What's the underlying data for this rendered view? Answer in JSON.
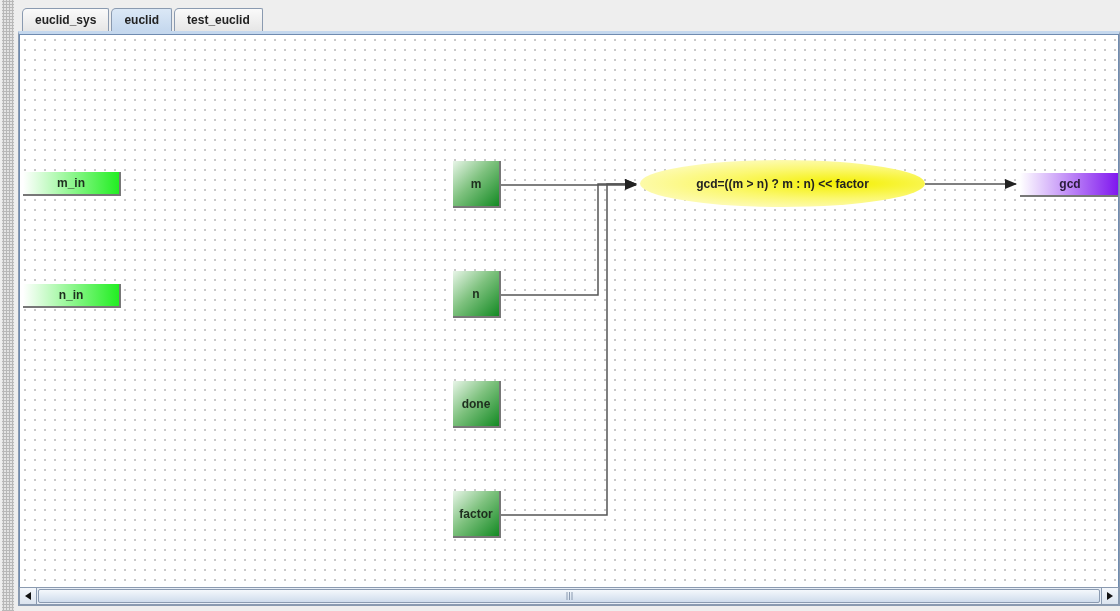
{
  "tabs": [
    {
      "label": "euclid_sys",
      "selected": false
    },
    {
      "label": "euclid",
      "selected": true
    },
    {
      "label": "test_euclid",
      "selected": false
    }
  ],
  "diagram": {
    "nodes": [
      {
        "kind": "input",
        "label": "m_in"
      },
      {
        "kind": "input",
        "label": "n_in"
      },
      {
        "kind": "port",
        "label": "m"
      },
      {
        "kind": "port",
        "label": "n"
      },
      {
        "kind": "port",
        "label": "done"
      },
      {
        "kind": "port",
        "label": "factor"
      },
      {
        "kind": "expression",
        "label": "gcd=((m > n) ? m : n) << factor"
      },
      {
        "kind": "output",
        "label": "gcd"
      }
    ]
  }
}
